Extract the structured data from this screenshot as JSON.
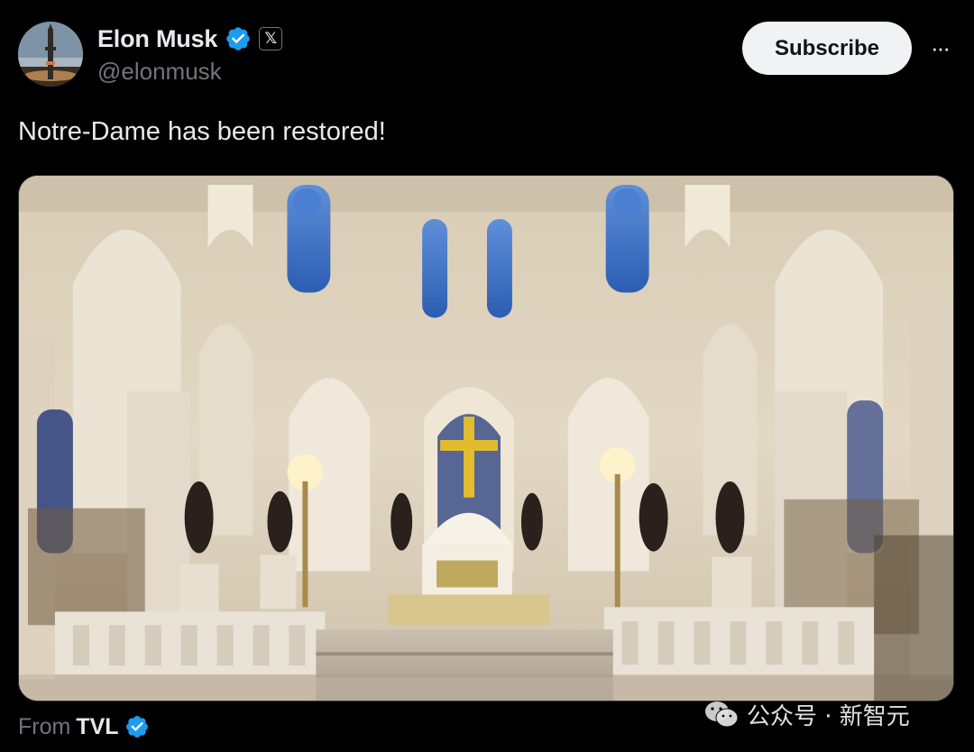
{
  "author": {
    "display_name": "Elon Musk",
    "handle": "@elonmusk",
    "verified_icon": "verified-badge-icon",
    "affiliate_badge": "𝕏"
  },
  "actions": {
    "subscribe_label": "Subscribe",
    "more_label": "···"
  },
  "tweet": {
    "text": "Notre-Dame has been restored!"
  },
  "media": {
    "type": "video",
    "description_icon": "cathedral-video-frame"
  },
  "source": {
    "from_label": "From",
    "from_name": "TVL"
  },
  "watermark": {
    "text": "公众号 · 新智元",
    "icon": "wechat-icon"
  },
  "colors": {
    "background": "#000000",
    "text_primary": "#e7e9ea",
    "text_secondary": "#71767b",
    "verified_blue": "#1d9bf0",
    "button_bg": "#eff3f4"
  }
}
